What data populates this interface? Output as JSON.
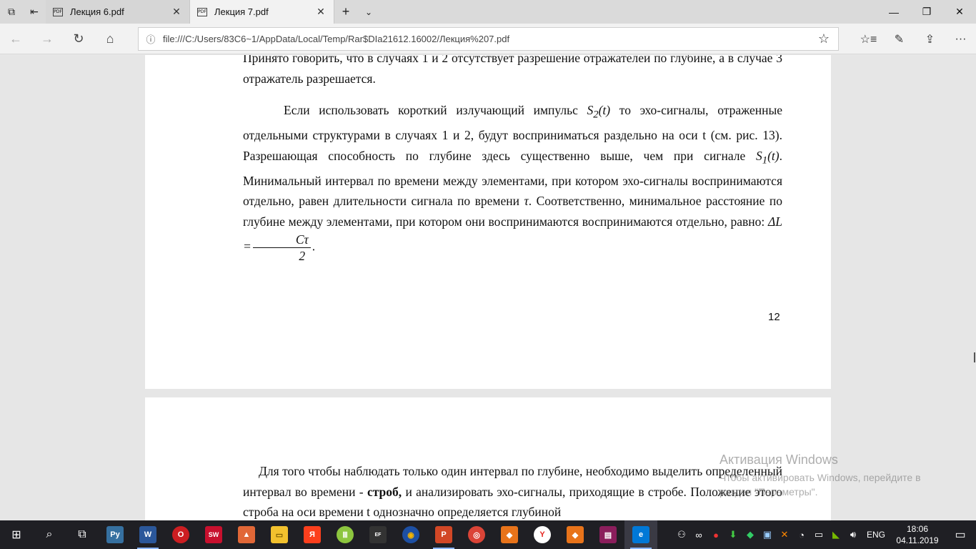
{
  "tabs": [
    {
      "title": "Лекция 6.pdf",
      "icon": "pdf-icon",
      "active": false
    },
    {
      "title": "Лекция 7.pdf",
      "icon": "pdf-icon",
      "active": true
    }
  ],
  "address_bar": {
    "url": "file:///C:/Users/83C6~1/AppData/Local/Temp/Rar$DIa21612.16002/Лекция%207.pdf"
  },
  "document": {
    "page1": {
      "para1": "Принято говорить, что в случаях 1 и 2 отсутствует разрешение отражателей по глубине, а в случае 3 отражатель разрешается.",
      "para2_a": "Если использовать короткий излучающий импульс",
      "math_s2": "S",
      "math_s2_sub": "2",
      "math_t": "(t)",
      "para2_b": "то эхо-сигналы, отраженные отдельными структурами в случаях 1 и 2, будут восприниматься раздельно на оси t (см. рис. 13). Разрешающая способность по глубине здесь существенно выше, чем при сигнале",
      "math_s1": "S",
      "math_s1_sub": "1",
      "para2_c": ". Минимальный интервал по времени между элементами, при котором эхо-сигналы воспринимаются отдельно, равен длительности сигнала по времени",
      "math_tau": "τ",
      "para2_d": ". Соответственно, минимальное расстояние по глубине между элементами, при котором они воспринимаются воспринимаются отдельно, равно:",
      "math_dl": "ΔL =",
      "frac_num": "Cτ",
      "frac_den": "2",
      "period": ".",
      "page_number": "12"
    },
    "page2": {
      "para1_a": "Для того чтобы наблюдать только один интервал по глубине, необходимо выделить определенный интервал во времени -",
      "bold": "строб,",
      "para1_b": "и анализировать эхо-сигналы, приходящие в стробе. Положение этого строба на оси времени t однозначно определяется глубиной"
    }
  },
  "watermark": {
    "title": "Активация Windows",
    "text": "Чтобы активировать Windows, перейдите в раздел \"Параметры\"."
  },
  "taskbar": {
    "language": "ENG",
    "time": "18:06",
    "date": "04.11.2019"
  }
}
